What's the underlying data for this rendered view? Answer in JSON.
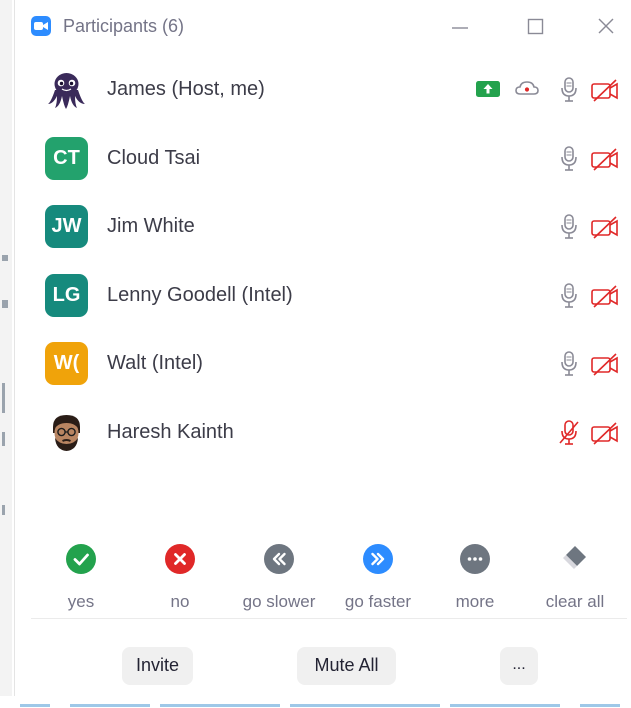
{
  "window": {
    "title": "Participants (6)"
  },
  "participants": [
    {
      "name": "James (Host, me)",
      "avatar": "octopus",
      "mic": "on",
      "video": "off",
      "sharing": true,
      "recording_icon": true
    },
    {
      "name": "Cloud Tsai",
      "initials": "CT",
      "avatar_color": "#23a26d",
      "mic": "on",
      "video": "off"
    },
    {
      "name": "Jim White",
      "initials": "JW",
      "avatar_color": "#168a7d",
      "mic": "on",
      "video": "off"
    },
    {
      "name": "Lenny Goodell (Intel)",
      "initials": "LG",
      "avatar_color": "#168a7d",
      "mic": "on",
      "video": "off"
    },
    {
      "name": "Walt (Intel)",
      "initials": "W(",
      "avatar_color": "#f0a30a",
      "mic": "on",
      "video": "off"
    },
    {
      "name": "Haresh Kainth",
      "avatar": "photo",
      "mic": "muted",
      "video": "off"
    }
  ],
  "feedback": [
    {
      "label": "yes",
      "icon": "checkmark-icon",
      "color": "#23a24d"
    },
    {
      "label": "no",
      "icon": "x-icon",
      "color": "#e02828"
    },
    {
      "label": "go slower",
      "icon": "rewind-icon",
      "color": "#6e7680"
    },
    {
      "label": "go faster",
      "icon": "fast-forward-icon",
      "color": "#2d8cff"
    },
    {
      "label": "more",
      "icon": "ellipsis-icon",
      "color": "#6e7680"
    },
    {
      "label": "clear all",
      "icon": "eraser-icon",
      "color": "#6e7680"
    }
  ],
  "footer": {
    "invite_label": "Invite",
    "mute_all_label": "Mute All",
    "more_label": "..."
  },
  "colors": {
    "accent": "#2d8cff",
    "muted_red": "#e02828",
    "icon_gray": "#747487",
    "share_green": "#23a24d"
  }
}
